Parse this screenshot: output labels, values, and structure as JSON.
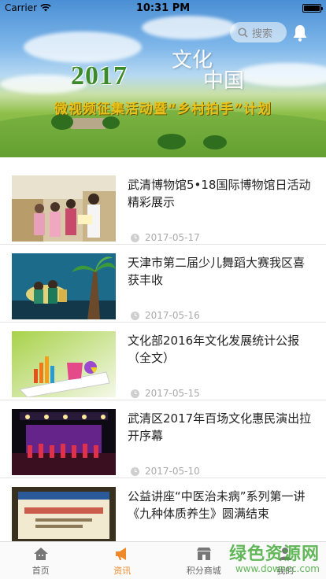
{
  "status": {
    "carrier": "Carrier",
    "time": "10:31 PM"
  },
  "banner": {
    "year": "2017",
    "calligraphy_line1": "文化",
    "calligraphy_line2": "中国",
    "slogan": "微视频征集活动暨“乡村拍手”计划"
  },
  "search": {
    "placeholder": "搜索"
  },
  "news": [
    {
      "title": "武清博物馆5•18国际博物馆日活动精彩展示",
      "date": "2017-05-17"
    },
    {
      "title": "天津市第二届少儿舞蹈大赛我区喜获丰收",
      "date": "2017-05-16"
    },
    {
      "title": "文化部2016年文化发展统计公报（全文）",
      "date": "2017-05-15"
    },
    {
      "title": "武清区2017年百场文化惠民演出拉开序幕",
      "date": "2017-05-10"
    },
    {
      "title": "公益讲座“中医治未病”系列第一讲《九种体质养生》圆满结束",
      "date": ""
    }
  ],
  "tabs": [
    {
      "label": "首页",
      "icon": "home-icon"
    },
    {
      "label": "资讯",
      "icon": "megaphone-icon",
      "active": true
    },
    {
      "label": "积分商城",
      "icon": "shop-icon"
    },
    {
      "label": "我的",
      "icon": "person-icon"
    }
  ],
  "watermark": {
    "cn": "绿色资源网",
    "en": "www.downcc.com"
  },
  "colors": {
    "accent": "#f08a28",
    "watermark": "#46aa3c",
    "slogan": "#e8c21a"
  }
}
